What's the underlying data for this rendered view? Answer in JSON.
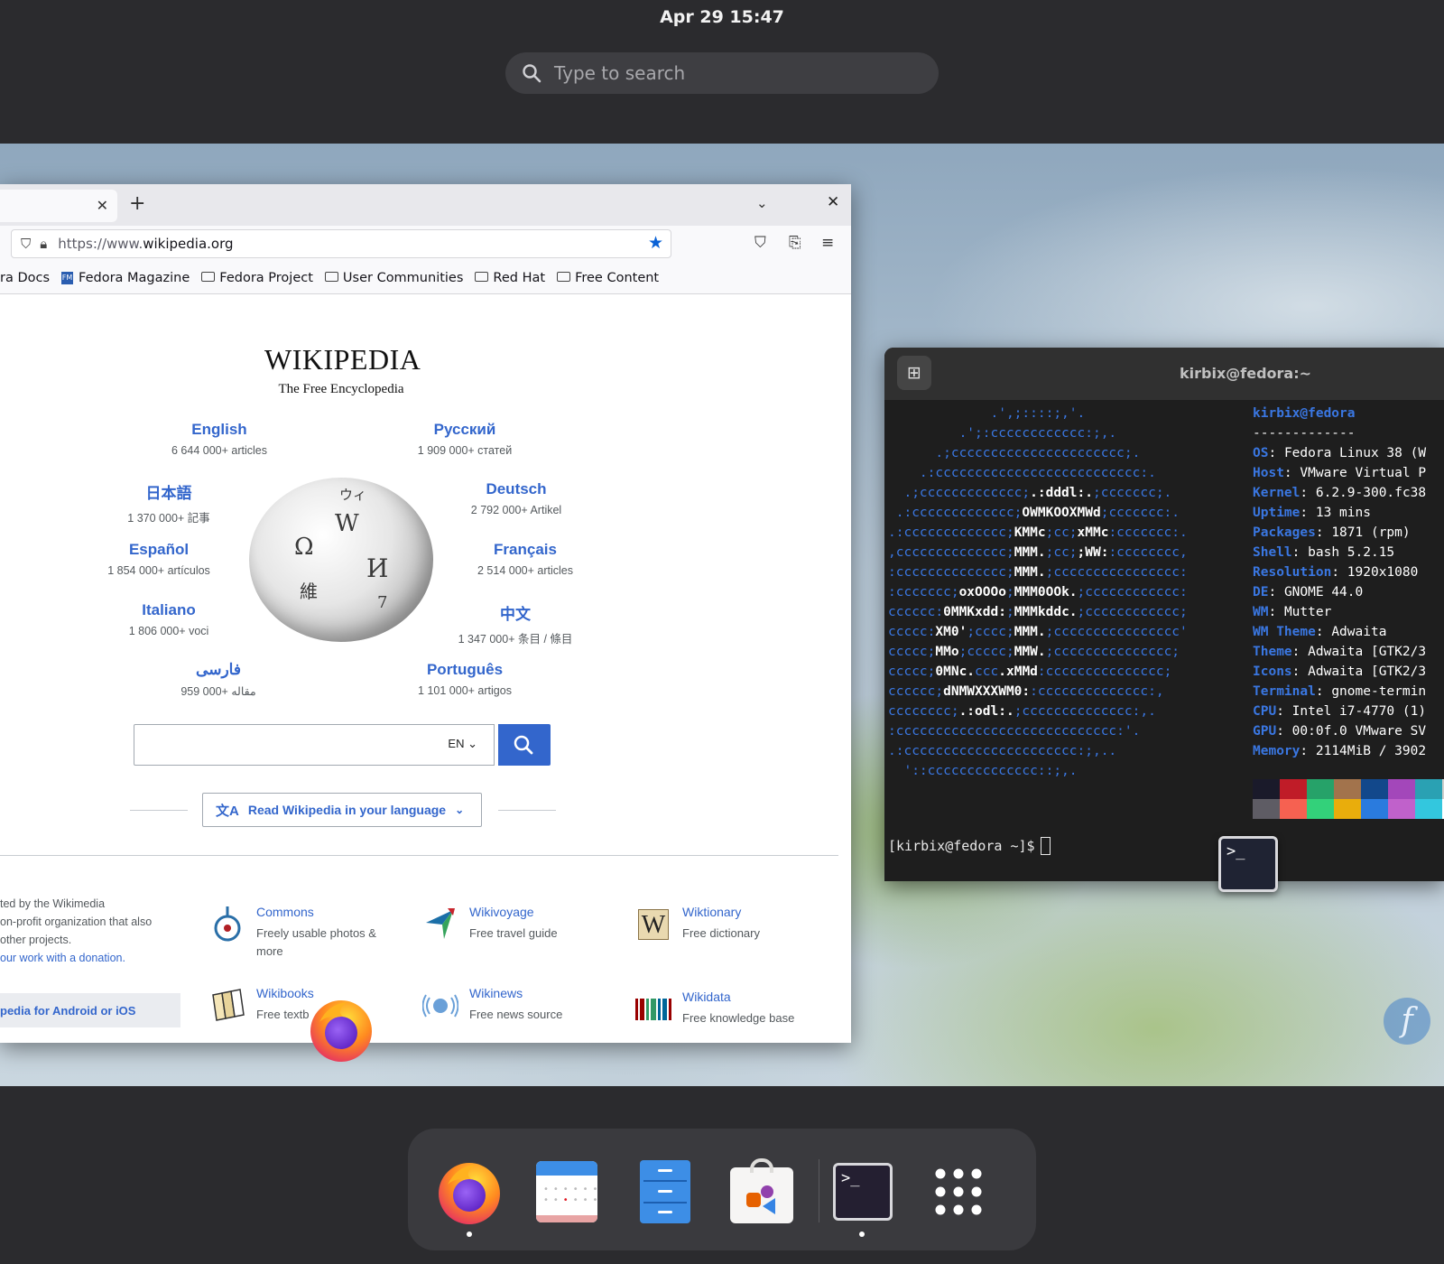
{
  "topbar": {
    "clock": "Apr 29  15:47"
  },
  "search": {
    "placeholder": "Type to search"
  },
  "browser": {
    "url_prefix": "https://www.",
    "url_domain": "wikipedia.org",
    "bookmarks": [
      "ra Docs",
      "Fedora Magazine",
      "Fedora Project",
      "User Communities",
      "Red Hat",
      "Free Content"
    ],
    "wiki": {
      "title": "WIKIPEDIA",
      "subtitle": "The Free Encyclopedia",
      "languages": [
        {
          "name": "English",
          "count": "6 644 000+ articles"
        },
        {
          "name": "Русский",
          "count": "1 909 000+ статей"
        },
        {
          "name": "日本語",
          "count": "1 370 000+ 記事"
        },
        {
          "name": "Deutsch",
          "count": "2 792 000+ Artikel"
        },
        {
          "name": "Español",
          "count": "1 854 000+ artículos"
        },
        {
          "name": "Français",
          "count": "2 514 000+ articles"
        },
        {
          "name": "Italiano",
          "count": "1 806 000+ voci"
        },
        {
          "name": "中文",
          "count": "1 347 000+ 条目 / 條目"
        },
        {
          "name": "فارسی",
          "count": "959 000+ مقاله"
        },
        {
          "name": "Português",
          "count": "1 101 000+ artigos"
        }
      ],
      "search_lang": "EN",
      "read_in_language": "Read Wikipedia in your language",
      "footer_lines": [
        "ted by the Wikimedia",
        "on-profit organization that also",
        "other projects."
      ],
      "footer_link": "our work with a donation.",
      "app_banner": "pedia for Android or iOS",
      "projects": [
        {
          "name": "Commons",
          "desc": "Freely usable photos &",
          "desc2": "more"
        },
        {
          "name": "Wikivoyage",
          "desc": "Free travel guide"
        },
        {
          "name": "Wiktionary",
          "desc": "Free dictionary"
        },
        {
          "name": "Wikibooks",
          "desc": "Free textb"
        },
        {
          "name": "Wikinews",
          "desc": "Free news source"
        },
        {
          "name": "Wikidata",
          "desc": "Free knowledge base"
        }
      ]
    }
  },
  "terminal": {
    "title": "kirbix@fedora:~",
    "user_host": "kirbix@fedora",
    "separator": "-------------",
    "info": [
      {
        "key": "OS",
        "value": "Fedora Linux 38 (W"
      },
      {
        "key": "Host",
        "value": "VMware Virtual P"
      },
      {
        "key": "Kernel",
        "value": "6.2.9-300.fc38"
      },
      {
        "key": "Uptime",
        "value": "13 mins"
      },
      {
        "key": "Packages",
        "value": "1871 (rpm)"
      },
      {
        "key": "Shell",
        "value": "bash 5.2.15"
      },
      {
        "key": "Resolution",
        "value": "1920x1080"
      },
      {
        "key": "DE",
        "value": "GNOME 44.0"
      },
      {
        "key": "WM",
        "value": "Mutter"
      },
      {
        "key": "WM Theme",
        "value": "Adwaita"
      },
      {
        "key": "Theme",
        "value": "Adwaita [GTK2/3"
      },
      {
        "key": "Icons",
        "value": "Adwaita [GTK2/3"
      },
      {
        "key": "Terminal",
        "value": "gnome-termin"
      },
      {
        "key": "CPU",
        "value": "Intel i7-4770 (1)"
      },
      {
        "key": "GPU",
        "value": "00:0f.0 VMware SV"
      },
      {
        "key": "Memory",
        "value": "2114MiB / 3902"
      }
    ],
    "palette_dark": [
      "#1a1a2a",
      "#c01c28",
      "#26a269",
      "#a2734c",
      "#12488b",
      "#a347ba",
      "#2aa1b3",
      "#d0cfcc"
    ],
    "palette_bright": [
      "#5e5c64",
      "#f66151",
      "#33d17a",
      "#e9ad0c",
      "#2a7bde",
      "#c061cb",
      "#33c7de",
      "#ffffff"
    ],
    "prompt": "[kirbix@fedora ~]$"
  },
  "dock": {
    "apps": [
      "firefox-icon",
      "calendar-icon",
      "files-icon",
      "software-icon",
      "terminal-icon",
      "app-grid-icon"
    ]
  }
}
